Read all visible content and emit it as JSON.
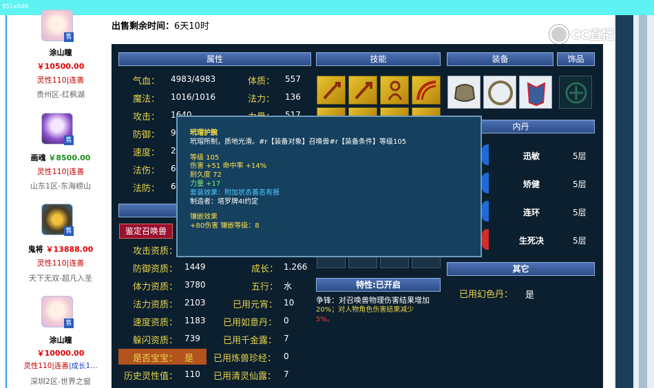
{
  "window": {
    "size_label": "951x640"
  },
  "pets": [
    {
      "name": "涂山瞳",
      "price": "￥10500.00",
      "tag": "灵性110|连善",
      "server": "贵州区-红枫湖",
      "badge": "售"
    },
    {
      "name": "画魂",
      "price": "￥8500.00",
      "tag": "灵性110|连善",
      "server": "山东1区-东海崂山",
      "badge": "售"
    },
    {
      "name": "鬼将",
      "price": "￥13888.00",
      "tag": "灵性110|连善",
      "server": "天下无双-超凡入圣",
      "badge": "售"
    },
    {
      "name": "涂山瞳",
      "price": "￥10000.00",
      "tag": "灵性110|连善",
      "tag2": "|成长1…",
      "server": "深圳2区-世界之窗",
      "badge": "售"
    }
  ],
  "sale": {
    "label": "出售剩余时间：",
    "value": "6天10时"
  },
  "logo": {
    "text": "CC直播"
  },
  "sections": {
    "attr": "属性",
    "skill": "技能",
    "equip": "装备",
    "ornament": "饰品",
    "neidan": "内丹",
    "other": "其它",
    "feature": "特性:已开启"
  },
  "appraise_btn": "鉴定召唤兽",
  "attrs": [
    {
      "label": "气血：",
      "value": "4983/4983",
      "label2": "体质：",
      "value2": "557"
    },
    {
      "label": "魔法：",
      "value": "1016/1016",
      "label2": "法力：",
      "value2": "136"
    },
    {
      "label": "攻击：",
      "value": "1640",
      "label2": "力量：",
      "value2": "517"
    },
    {
      "label": "防御：",
      "value": "9",
      "label2": "",
      "value2": ""
    },
    {
      "label": "速度：",
      "value": "2",
      "label2": "",
      "value2": ""
    },
    {
      "label": "法伤：",
      "value": "6",
      "label2": "",
      "value2": ""
    },
    {
      "label": "法防：",
      "value": "6",
      "label2": "",
      "value2": ""
    }
  ],
  "zizhi": [
    {
      "label": "攻击资质：",
      "value": "",
      "label2": "",
      "value2": ""
    },
    {
      "label": "防御资质：",
      "value": "1449",
      "label2": "成长：",
      "value2": "1.266"
    },
    {
      "label": "体力资质：",
      "value": "3780",
      "label2": "五行：",
      "value2": "水"
    },
    {
      "label": "法力资质：",
      "value": "2103",
      "label2": "已用元宵：",
      "value2": "10"
    },
    {
      "label": "速度资质：",
      "value": "1183",
      "label2": "已用如意丹：",
      "value2": "0"
    },
    {
      "label": "躲闪资质：",
      "value": "739",
      "label2": "已用千金露：",
      "value2": "7"
    },
    {
      "label": "是否宝宝：",
      "value": "是",
      "label2": "已用炼兽珍经：",
      "value2": "0"
    },
    {
      "label": "历史灵性值：",
      "value": "110",
      "label2": "已用清灵仙露：",
      "value2": "7"
    }
  ],
  "neidan": [
    {
      "name": "迅敏",
      "level": "5层"
    },
    {
      "name": "矫健",
      "level": "5层"
    },
    {
      "name": "连环",
      "level": "5层"
    },
    {
      "name": "生死决",
      "level": "5层"
    }
  ],
  "other": {
    "label": "已用幻色丹：",
    "value": "是"
  },
  "feature_desc": {
    "line1": "争锋：对召唤兽物理伤害结果增加",
    "line2": "20%；对人物角色伤害结果减少",
    "line3": "5%。"
  },
  "tooltip": {
    "title": "玳瑁护腕",
    "desc": "玳瑁所制，质地光滑。#r【装备对象】召唤兽#r【装备条件】等级105",
    "level": "等级 105",
    "damage": "伤害 +51 命中率 +14%",
    "durability": "耐久度 72",
    "strength": "力量 +17",
    "set_effect": "套装效果：附加状态善恶有报",
    "maker": "制造者：塔罗牌4I约定",
    "inlay_title": "镶嵌效果",
    "inlay_value": "+80伤害 镶嵌等级：8"
  },
  "colors": {
    "panel": "#0c1f2f",
    "header": "#3b5fa0",
    "label": "#e6d34a",
    "price": "#e00000"
  }
}
